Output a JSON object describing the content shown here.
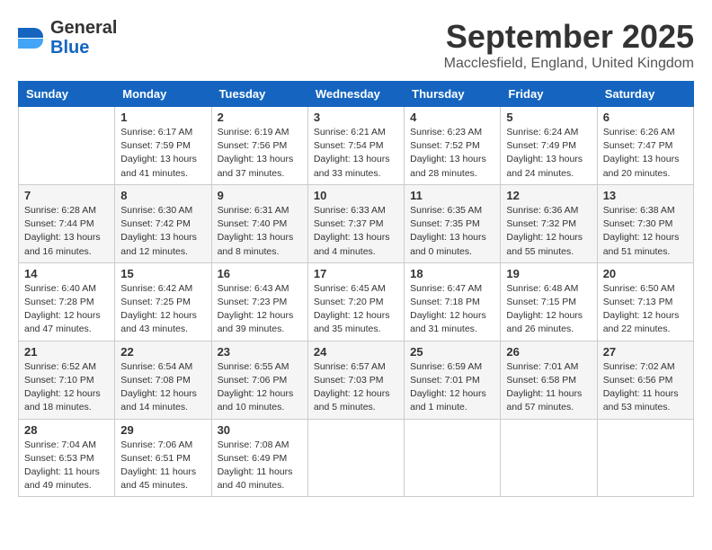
{
  "header": {
    "logo_line1": "General",
    "logo_line2": "Blue",
    "month_year": "September 2025",
    "location": "Macclesfield, England, United Kingdom"
  },
  "weekdays": [
    "Sunday",
    "Monday",
    "Tuesday",
    "Wednesday",
    "Thursday",
    "Friday",
    "Saturday"
  ],
  "weeks": [
    [
      {
        "day": "",
        "info": ""
      },
      {
        "day": "1",
        "info": "Sunrise: 6:17 AM\nSunset: 7:59 PM\nDaylight: 13 hours\nand 41 minutes."
      },
      {
        "day": "2",
        "info": "Sunrise: 6:19 AM\nSunset: 7:56 PM\nDaylight: 13 hours\nand 37 minutes."
      },
      {
        "day": "3",
        "info": "Sunrise: 6:21 AM\nSunset: 7:54 PM\nDaylight: 13 hours\nand 33 minutes."
      },
      {
        "day": "4",
        "info": "Sunrise: 6:23 AM\nSunset: 7:52 PM\nDaylight: 13 hours\nand 28 minutes."
      },
      {
        "day": "5",
        "info": "Sunrise: 6:24 AM\nSunset: 7:49 PM\nDaylight: 13 hours\nand 24 minutes."
      },
      {
        "day": "6",
        "info": "Sunrise: 6:26 AM\nSunset: 7:47 PM\nDaylight: 13 hours\nand 20 minutes."
      }
    ],
    [
      {
        "day": "7",
        "info": "Sunrise: 6:28 AM\nSunset: 7:44 PM\nDaylight: 13 hours\nand 16 minutes."
      },
      {
        "day": "8",
        "info": "Sunrise: 6:30 AM\nSunset: 7:42 PM\nDaylight: 13 hours\nand 12 minutes."
      },
      {
        "day": "9",
        "info": "Sunrise: 6:31 AM\nSunset: 7:40 PM\nDaylight: 13 hours\nand 8 minutes."
      },
      {
        "day": "10",
        "info": "Sunrise: 6:33 AM\nSunset: 7:37 PM\nDaylight: 13 hours\nand 4 minutes."
      },
      {
        "day": "11",
        "info": "Sunrise: 6:35 AM\nSunset: 7:35 PM\nDaylight: 13 hours\nand 0 minutes."
      },
      {
        "day": "12",
        "info": "Sunrise: 6:36 AM\nSunset: 7:32 PM\nDaylight: 12 hours\nand 55 minutes."
      },
      {
        "day": "13",
        "info": "Sunrise: 6:38 AM\nSunset: 7:30 PM\nDaylight: 12 hours\nand 51 minutes."
      }
    ],
    [
      {
        "day": "14",
        "info": "Sunrise: 6:40 AM\nSunset: 7:28 PM\nDaylight: 12 hours\nand 47 minutes."
      },
      {
        "day": "15",
        "info": "Sunrise: 6:42 AM\nSunset: 7:25 PM\nDaylight: 12 hours\nand 43 minutes."
      },
      {
        "day": "16",
        "info": "Sunrise: 6:43 AM\nSunset: 7:23 PM\nDaylight: 12 hours\nand 39 minutes."
      },
      {
        "day": "17",
        "info": "Sunrise: 6:45 AM\nSunset: 7:20 PM\nDaylight: 12 hours\nand 35 minutes."
      },
      {
        "day": "18",
        "info": "Sunrise: 6:47 AM\nSunset: 7:18 PM\nDaylight: 12 hours\nand 31 minutes."
      },
      {
        "day": "19",
        "info": "Sunrise: 6:48 AM\nSunset: 7:15 PM\nDaylight: 12 hours\nand 26 minutes."
      },
      {
        "day": "20",
        "info": "Sunrise: 6:50 AM\nSunset: 7:13 PM\nDaylight: 12 hours\nand 22 minutes."
      }
    ],
    [
      {
        "day": "21",
        "info": "Sunrise: 6:52 AM\nSunset: 7:10 PM\nDaylight: 12 hours\nand 18 minutes."
      },
      {
        "day": "22",
        "info": "Sunrise: 6:54 AM\nSunset: 7:08 PM\nDaylight: 12 hours\nand 14 minutes."
      },
      {
        "day": "23",
        "info": "Sunrise: 6:55 AM\nSunset: 7:06 PM\nDaylight: 12 hours\nand 10 minutes."
      },
      {
        "day": "24",
        "info": "Sunrise: 6:57 AM\nSunset: 7:03 PM\nDaylight: 12 hours\nand 5 minutes."
      },
      {
        "day": "25",
        "info": "Sunrise: 6:59 AM\nSunset: 7:01 PM\nDaylight: 12 hours\nand 1 minute."
      },
      {
        "day": "26",
        "info": "Sunrise: 7:01 AM\nSunset: 6:58 PM\nDaylight: 11 hours\nand 57 minutes."
      },
      {
        "day": "27",
        "info": "Sunrise: 7:02 AM\nSunset: 6:56 PM\nDaylight: 11 hours\nand 53 minutes."
      }
    ],
    [
      {
        "day": "28",
        "info": "Sunrise: 7:04 AM\nSunset: 6:53 PM\nDaylight: 11 hours\nand 49 minutes."
      },
      {
        "day": "29",
        "info": "Sunrise: 7:06 AM\nSunset: 6:51 PM\nDaylight: 11 hours\nand 45 minutes."
      },
      {
        "day": "30",
        "info": "Sunrise: 7:08 AM\nSunset: 6:49 PM\nDaylight: 11 hours\nand 40 minutes."
      },
      {
        "day": "",
        "info": ""
      },
      {
        "day": "",
        "info": ""
      },
      {
        "day": "",
        "info": ""
      },
      {
        "day": "",
        "info": ""
      }
    ]
  ]
}
